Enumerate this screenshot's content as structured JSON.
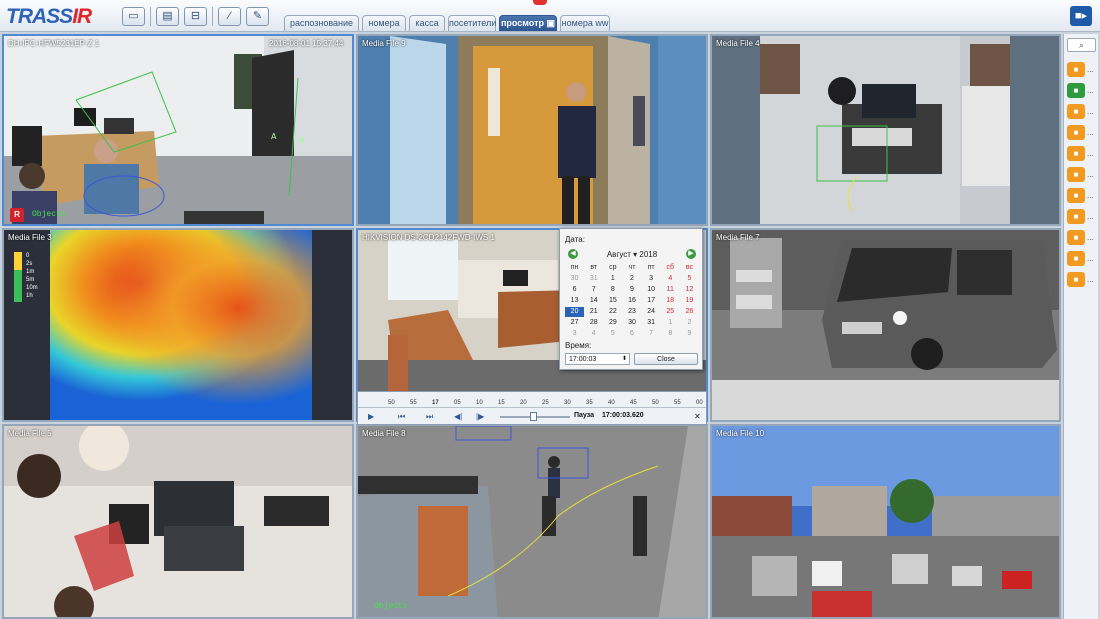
{
  "app": {
    "logo_main": "TRASS",
    "logo_accent": "IR"
  },
  "toolbar": {
    "icons": [
      "cassette-icon",
      "chat-icon",
      "layout-icon",
      "magic-wand-icon",
      "edit-icon"
    ]
  },
  "tabs": [
    {
      "label": "распознование лиц",
      "active": false
    },
    {
      "label": "номера",
      "active": false
    },
    {
      "label": "касса",
      "active": false
    },
    {
      "label": "посетители",
      "active": false
    },
    {
      "label": "просмотр",
      "active": true
    },
    {
      "label": "номера ww",
      "active": false
    }
  ],
  "cameras": [
    {
      "title": "DH-IPC-HFW5231EP-Z 1",
      "timestamp": "2016-08-01 15:37:44",
      "badge": "R",
      "overlay": "Objects"
    },
    {
      "title": "Media File 9"
    },
    {
      "title": "Media File 4"
    },
    {
      "title": "Media File 3",
      "scale": [
        "0",
        "2s",
        "1m",
        "5m",
        "10m",
        "1h"
      ]
    },
    {
      "title": "HIKVISION DS-2CD2142FWD-IWS 1"
    },
    {
      "title": "Media File 7"
    },
    {
      "title": "Media File 5"
    },
    {
      "title": "Media File 8",
      "overlay": "Objects"
    },
    {
      "title": "Media File 10"
    }
  ],
  "calendar": {
    "date_label": "Дата:",
    "month": "Август",
    "year": "2018",
    "weekdays": [
      "пн",
      "вт",
      "ср",
      "чт",
      "пт",
      "сб",
      "вс"
    ],
    "weeks": [
      [
        "30",
        "31",
        "1",
        "2",
        "3",
        "4",
        "5"
      ],
      [
        "6",
        "7",
        "8",
        "9",
        "10",
        "11",
        "12"
      ],
      [
        "13",
        "14",
        "15",
        "16",
        "17",
        "18",
        "19"
      ],
      [
        "20",
        "21",
        "22",
        "23",
        "24",
        "25",
        "26"
      ],
      [
        "27",
        "28",
        "29",
        "30",
        "31",
        "1",
        "2"
      ],
      [
        "3",
        "4",
        "5",
        "6",
        "7",
        "8",
        "9"
      ]
    ],
    "selected": "20",
    "time_label": "Время:",
    "time_value": "17:00:03",
    "close_label": "Close"
  },
  "playback": {
    "ticks": [
      "50",
      "55",
      "17",
      "05",
      "10",
      "15",
      "20",
      "25",
      "30",
      "35",
      "40",
      "45",
      "50",
      "55",
      "00"
    ],
    "status": "Пауза",
    "time": "17:00:03.620"
  },
  "right_panel": {
    "item_count": 11,
    "green_index": 1,
    "dots": "..."
  },
  "colors": {
    "accent": "#2e5590",
    "active_tab": "#3a66a3",
    "cam_orange": "#f09a21",
    "cam_green": "#2f9b3e"
  }
}
